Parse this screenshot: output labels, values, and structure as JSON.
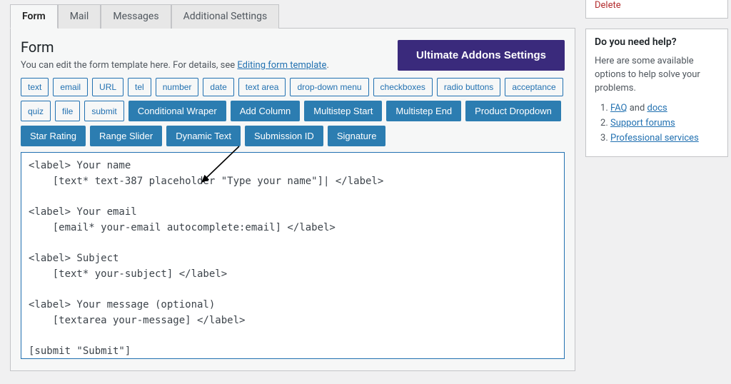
{
  "tabs": {
    "form": "Form",
    "mail": "Mail",
    "messages": "Messages",
    "additional": "Additional Settings"
  },
  "panel": {
    "title": "Form",
    "desc_pre": "You can edit the form template here. For details, see ",
    "desc_link": "Editing form template",
    "desc_post": "."
  },
  "ua_button": "Ultimate Addons Settings",
  "tags": {
    "outline": [
      "text",
      "email",
      "URL",
      "tel",
      "number",
      "date",
      "text area",
      "drop-down menu",
      "checkboxes",
      "radio buttons",
      "acceptance",
      "quiz",
      "file",
      "submit"
    ],
    "solid": [
      "Conditional Wraper",
      "Add Column",
      "Multistep Start",
      "Multistep End",
      "Product Dropdown",
      "Star Rating",
      "Range Slider",
      "Dynamic Text",
      "Submission ID",
      "Signature"
    ]
  },
  "code": "<label> Your name\n    [text* text-387 placeholder \"Type your name\"]| </label>\n\n<label> Your email\n    [email* your-email autocomplete:email] </label>\n\n<label> Subject\n    [text* your-subject] </label>\n\n<label> Your message (optional)\n    [textarea your-message] </label>\n\n[submit \"Submit\"]",
  "sidebar": {
    "delete": "Delete",
    "help_title": "Do you need help?",
    "help_text": "Here are some available options to help solve your problems.",
    "items": [
      {
        "pre": "",
        "links": [
          {
            "t": "FAQ"
          },
          {
            "raw": " and "
          },
          {
            "t": "docs"
          }
        ]
      },
      {
        "pre": "",
        "links": [
          {
            "t": "Support forums"
          }
        ]
      },
      {
        "pre": "",
        "links": [
          {
            "t": "Professional services"
          }
        ]
      }
    ]
  }
}
